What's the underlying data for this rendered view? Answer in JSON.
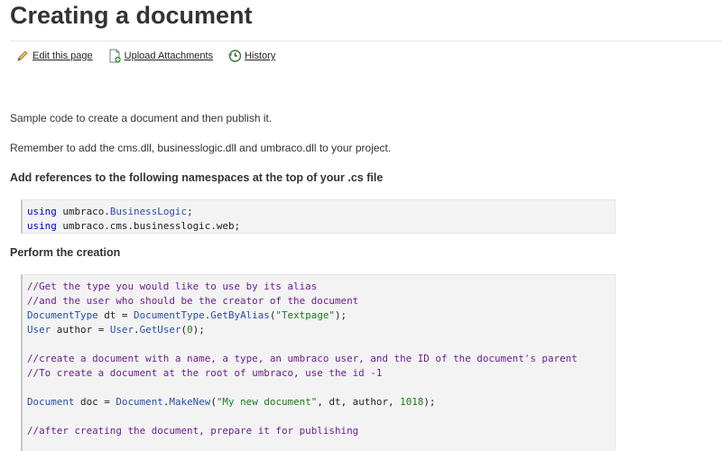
{
  "page": {
    "title": "Creating a document"
  },
  "toolbar": {
    "edit_label": "Edit this page",
    "upload_label": "Upload Attachments",
    "history_label": "History"
  },
  "content": {
    "intro": "Sample code to create a document and then publish it.",
    "reminder": "Remember to add the cms.dll, businesslogic.dll and umbraco.dll to your project.",
    "heading_references": "Add references to the following namespaces at the top of your .cs file",
    "heading_creation": "Perform the creation"
  },
  "code_references": {
    "lines": [
      [
        {
          "t": "using",
          "c": "kw"
        },
        {
          "t": " umbraco.",
          "c": "id"
        },
        {
          "t": "BusinessLogic",
          "c": "tp"
        },
        {
          "t": ";",
          "c": "id"
        }
      ],
      [
        {
          "t": "using",
          "c": "kw"
        },
        {
          "t": " umbraco.cms.businesslogic.web;",
          "c": "id"
        }
      ]
    ]
  },
  "code_creation": {
    "lines": [
      [
        {
          "t": "//Get the type you would like to use by its alias",
          "c": "cm"
        }
      ],
      [
        {
          "t": "//and the user who should be the creator of the document",
          "c": "cm"
        }
      ],
      [
        {
          "t": "DocumentType",
          "c": "tp"
        },
        {
          "t": " dt = ",
          "c": "id"
        },
        {
          "t": "DocumentType",
          "c": "tp"
        },
        {
          "t": ".",
          "c": "id"
        },
        {
          "t": "GetByAlias",
          "c": "nm"
        },
        {
          "t": "(",
          "c": "id"
        },
        {
          "t": "\"Textpage\"",
          "c": "st"
        },
        {
          "t": ");",
          "c": "id"
        }
      ],
      [
        {
          "t": "User",
          "c": "tp"
        },
        {
          "t": " author = ",
          "c": "id"
        },
        {
          "t": "User",
          "c": "tp"
        },
        {
          "t": ".",
          "c": "id"
        },
        {
          "t": "GetUser",
          "c": "nm"
        },
        {
          "t": "(",
          "c": "id"
        },
        {
          "t": "0",
          "c": "num"
        },
        {
          "t": ");",
          "c": "id"
        }
      ],
      [],
      [
        {
          "t": "//create a document with a name, a type, an umbraco user, and the ID of the document's parent",
          "c": "cm"
        }
      ],
      [
        {
          "t": "//To create a document at the root of umbraco, use the id -1",
          "c": "cm"
        }
      ],
      [],
      [
        {
          "t": "Document",
          "c": "tp"
        },
        {
          "t": " doc = ",
          "c": "id"
        },
        {
          "t": "Document",
          "c": "tp"
        },
        {
          "t": ".",
          "c": "id"
        },
        {
          "t": "MakeNew",
          "c": "nm"
        },
        {
          "t": "(",
          "c": "id"
        },
        {
          "t": "\"My new document\"",
          "c": "st"
        },
        {
          "t": ", dt, author, ",
          "c": "id"
        },
        {
          "t": "1018",
          "c": "num"
        },
        {
          "t": ");",
          "c": "id"
        }
      ],
      [],
      [
        {
          "t": "//after creating the document, prepare it for publishing",
          "c": "cm"
        }
      ],
      []
    ]
  }
}
